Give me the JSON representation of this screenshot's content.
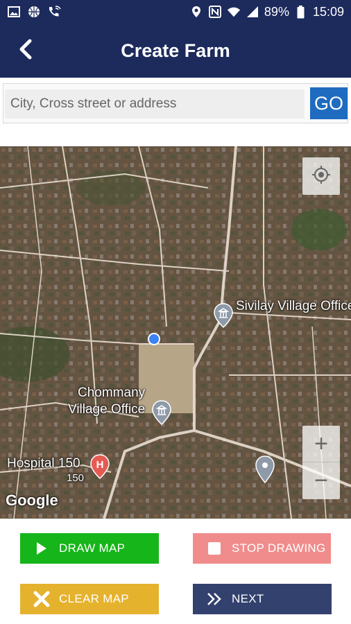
{
  "status_bar": {
    "battery": "89%",
    "time": "15:09",
    "left_icons": [
      "image-icon",
      "basketball-icon",
      "phone-wifi-icon"
    ],
    "right_icons": [
      "location-icon",
      "nfc-icon",
      "wifi-icon",
      "signal-icon",
      "battery-icon"
    ]
  },
  "header": {
    "title": "Create Farm",
    "back_icon": "chevron-left-icon",
    "background": "#1c2a5c"
  },
  "search": {
    "placeholder": "City, Cross street or address",
    "value": "",
    "go_label": "GO",
    "go_color": "#1e6bc0"
  },
  "map": {
    "labels": {
      "sivilay": "Sivilay Village Office",
      "chommany_line1": "Chommany",
      "chommany_line2": "Village Office",
      "hospital": "Hospital 150",
      "hospital_sub": "150"
    },
    "google": "Google",
    "zoom_in": "+",
    "zoom_out": "−"
  },
  "buttons": {
    "draw_map": "DRAW MAP",
    "stop_drawing": "STOP DRAWING",
    "clear_map": "CLEAR MAP",
    "next": "NEXT"
  },
  "colors": {
    "draw": "#16b51a",
    "stop": "#f08c8c",
    "clear": "#e5b22e",
    "next": "#33416e"
  }
}
